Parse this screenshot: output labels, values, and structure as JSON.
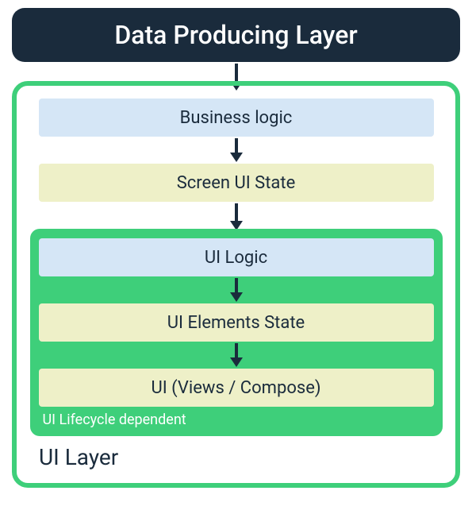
{
  "top": {
    "label": "Data Producing Layer",
    "bg": "#1a2b3c",
    "text": "#ffffff"
  },
  "uiLayer": {
    "label": "UI Layer",
    "border": "#3ecf7a",
    "boxes": {
      "businessLogic": {
        "label": "Business logic",
        "bg": "#d5e6f6",
        "text": "#1a2b3c"
      },
      "screenUiState": {
        "label": "Screen UI State",
        "bg": "#eef0c8",
        "text": "#1a2b3c"
      }
    },
    "lifecycle": {
      "label": "UI Lifecycle dependent",
      "bg": "#3ecf7a",
      "labelColor": "#ffffff",
      "boxes": {
        "uiLogic": {
          "label": "UI Logic",
          "bg": "#d5e6f6",
          "text": "#1a2b3c"
        },
        "uiElementsState": {
          "label": "UI Elements State",
          "bg": "#eef0c8",
          "text": "#1a2b3c"
        },
        "uiViews": {
          "label": "UI (Views / Compose)",
          "bg": "#eef0c8",
          "text": "#1a2b3c"
        }
      }
    }
  },
  "arrowColor": "#1a2b3c"
}
